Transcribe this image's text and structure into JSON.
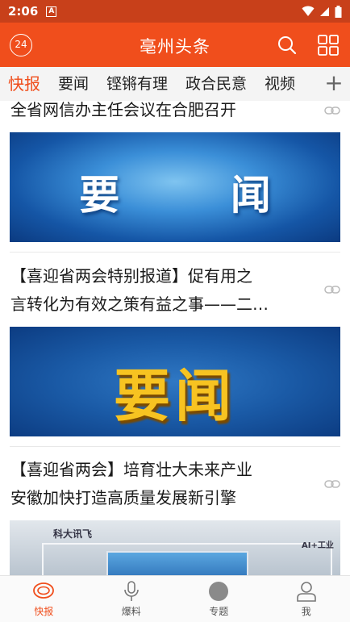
{
  "status_bar": {
    "time": "2:06",
    "notif_badge": "A"
  },
  "header": {
    "title": "亳州头条",
    "logo_text": "24"
  },
  "tabs": [
    {
      "label": "快报",
      "active": true
    },
    {
      "label": "要闻",
      "active": false
    },
    {
      "label": "铿锵有理",
      "active": false
    },
    {
      "label": "政合民意",
      "active": false
    },
    {
      "label": "视频",
      "active": false
    }
  ],
  "tabs_add": "+",
  "feed": [
    {
      "title": "全省网信办主任会议在合肥召开",
      "banner_text": "要 闻"
    },
    {
      "title_line1": "【喜迎省两会特别报道】促有用之",
      "title_line2": "言转化为有效之策有益之事——二…",
      "banner_text": "要闻"
    },
    {
      "title_line1": "【喜迎省两会】培育壮大未来产业",
      "title_line2": "安徽加快打造高质量发展新引擎",
      "banner_logo": "科大讯飞",
      "banner_tag": "AI+工业"
    }
  ],
  "bottom_nav": [
    {
      "label": "快报",
      "icon": "news-bubble-icon",
      "active": true
    },
    {
      "label": "爆料",
      "icon": "microphone-icon",
      "active": false
    },
    {
      "label": "专题",
      "icon": "topic-circle-icon",
      "active": false
    },
    {
      "label": "我",
      "icon": "user-icon",
      "active": false
    }
  ],
  "colors": {
    "brand": "#f04e1c",
    "status_bar": "#c8401a"
  }
}
